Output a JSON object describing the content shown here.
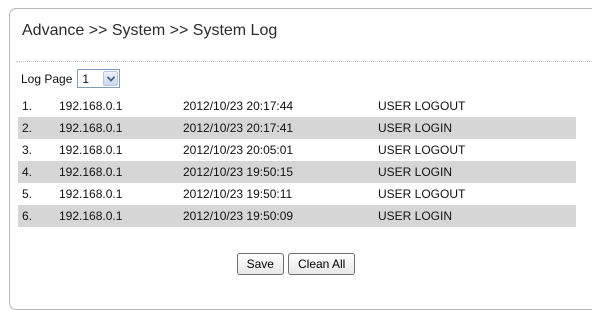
{
  "breadcrumb": "Advance >> System >> System Log",
  "log_page": {
    "label": "Log Page",
    "selected": "1"
  },
  "log_table": {
    "rows": [
      {
        "index": "1.",
        "ip": "192.168.0.1",
        "time": "2012/10/23 20:17:44",
        "event": "USER LOGOUT"
      },
      {
        "index": "2.",
        "ip": "192.168.0.1",
        "time": "2012/10/23 20:17:41",
        "event": "USER LOGIN"
      },
      {
        "index": "3.",
        "ip": "192.168.0.1",
        "time": "2012/10/23 20:05:01",
        "event": "USER LOGOUT"
      },
      {
        "index": "4.",
        "ip": "192.168.0.1",
        "time": "2012/10/23 19:50:15",
        "event": "USER LOGIN"
      },
      {
        "index": "5.",
        "ip": "192.168.0.1",
        "time": "2012/10/23 19:50:11",
        "event": "USER LOGOUT"
      },
      {
        "index": "6.",
        "ip": "192.168.0.1",
        "time": "2012/10/23 19:50:09",
        "event": "USER LOGIN"
      }
    ]
  },
  "buttons": {
    "save_label": "Save",
    "clean_all_label": "Clean All"
  },
  "icons": {
    "select_arrow": "chevron-down-icon"
  },
  "colors": {
    "alt_row_background": "#d6d6d6",
    "panel_border": "#b9b9b9",
    "select_arrow": "#4d6185"
  }
}
